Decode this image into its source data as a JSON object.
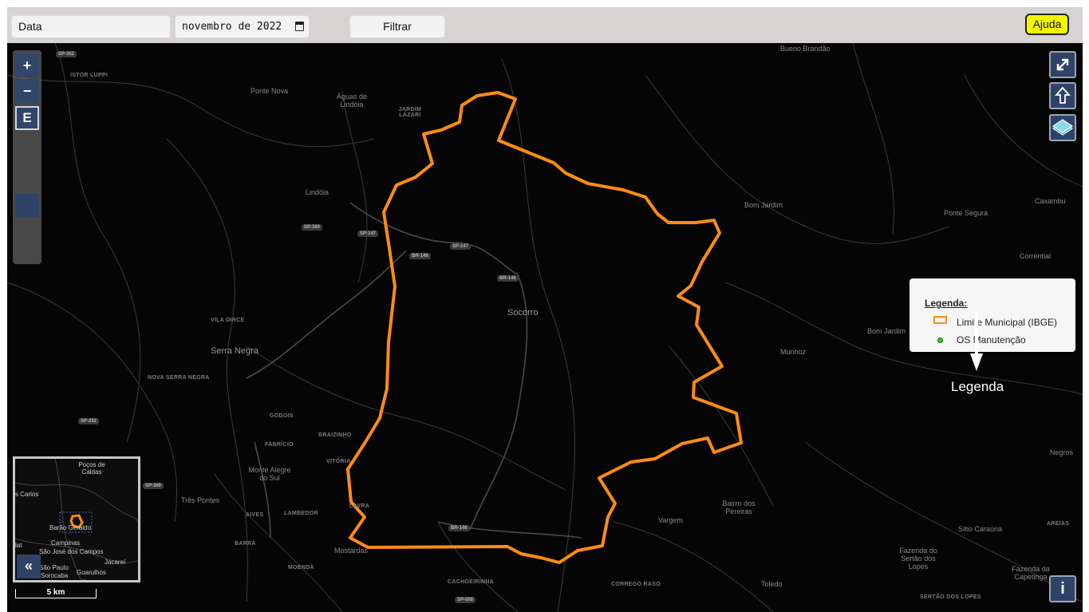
{
  "toolbar": {
    "date_filter_select": "Data",
    "month_input_value": "novembro de 2022",
    "filter_button": "Filtrar",
    "help_button": "Ajuda"
  },
  "map_controls": {
    "zoom_in": "+",
    "zoom_out": "−",
    "extent_button": "E",
    "fullscreen_icon": "expand-arrows-icon",
    "north_icon": "up-arrow-icon",
    "layers_icon": "layers-icon",
    "overview_toggle": "«",
    "info_button": "i"
  },
  "legend": {
    "title": "Legenda:",
    "items": [
      {
        "label": "Limite Municipal (IBGE)",
        "symbol": "orange-outline",
        "color": "#ff8c14"
      },
      {
        "label": "OS Manutenção",
        "symbol": "green-dot",
        "color": "#2ed12e"
      }
    ],
    "callout_label": "Legenda"
  },
  "scale_bar": {
    "label": "5 km"
  },
  "map_labels": {
    "places": [
      "Bueno Brandão",
      "Águas de Lindóia",
      "JARDIM LÁZARI",
      "Ponte Nova",
      "ISTOR LUPPI",
      "Lindóia",
      "Bom Jardim",
      "Ponte Segura",
      "Caxambu",
      "Corrential",
      "Socorro",
      "VILA DIRCE",
      "Serra Negra",
      "NOVA SERRA NEGRA",
      "Bom Jardim",
      "Munhoz",
      "GODOIS",
      "FABRÍCIO",
      "BRAIZINHO",
      "VITÓRIA",
      "Monte Alegre do Sul",
      "Três Pontes",
      "AIVES",
      "LAMBEDOR",
      "LAVRA",
      "BARRA",
      "Mostardas",
      "MOENDA",
      "CACHOEIRINHA",
      "CORREGO RASO",
      "Vargem",
      "Bairro dos Pereiras",
      "Toledo",
      "Negros",
      "AREIAS",
      "Sítio Caraúna",
      "Fazenda do Sertão dos Lopes",
      "Fazenda da Capetinga",
      "SERTÃO DOS LOPES"
    ],
    "road_shields": [
      "SP-352",
      "SP-360",
      "SP-147",
      "BR-146",
      "SP-147",
      "BR-146",
      "SP-252",
      "SP-360",
      "BR-146",
      "SP-008"
    ]
  },
  "overview_labels": [
    "Poços de Caldas",
    "s Carlos",
    "Barão Geraldo",
    "Campinas",
    "São José dos Campos",
    "São Paulo",
    "Jacareí",
    "Sorocaba",
    "Guarulhos",
    "lat"
  ]
}
